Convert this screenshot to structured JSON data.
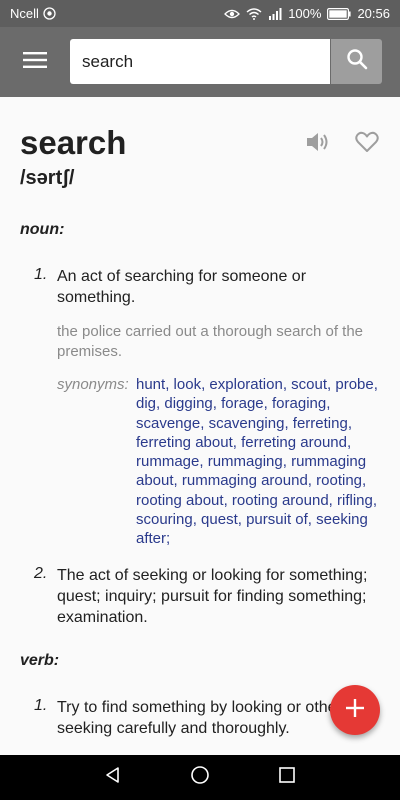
{
  "status_bar": {
    "carrier": "Ncell",
    "battery": "100%",
    "time": "20:56"
  },
  "search": {
    "value": "search",
    "placeholder": ""
  },
  "entry": {
    "word": "search",
    "pronunciation": "/sərtʃ/",
    "noun_label": "noun:",
    "verb_label": "verb:",
    "senses": [
      {
        "number": "1.",
        "definition": "An act of searching for someone or something.",
        "example": "the police carried out a thorough search of the premises.",
        "synonyms_label": "synonyms:",
        "synonyms": [
          "hunt",
          "look",
          "exploration",
          "scout",
          "probe",
          "dig",
          "digging",
          "forage",
          "foraging",
          "scavenge",
          "scavenging",
          "ferreting",
          "ferreting about",
          "ferreting around",
          "rummage",
          "rummaging",
          "rummaging about",
          "rummaging around",
          "rooting",
          "rooting about",
          "rooting around",
          "rifling",
          "scouring",
          "quest",
          "pursuit of",
          "seeking after"
        ]
      },
      {
        "number": "2.",
        "definition": "The act of seeking or looking for something; quest; inquiry; pursuit for finding something; examination."
      },
      {
        "number": "1.",
        "definition": "Try to find something by looking or otherwise seeking carefully and thoroughly."
      }
    ]
  },
  "colors": {
    "accent": "#e53935",
    "synonym_link": "#2a3a8c",
    "app_bar": "#6b6b6b"
  },
  "icons": {
    "menu": "hamburger-icon",
    "search": "search-icon",
    "speaker": "speaker-icon",
    "favorite": "heart-icon",
    "fab": "plus-icon"
  }
}
